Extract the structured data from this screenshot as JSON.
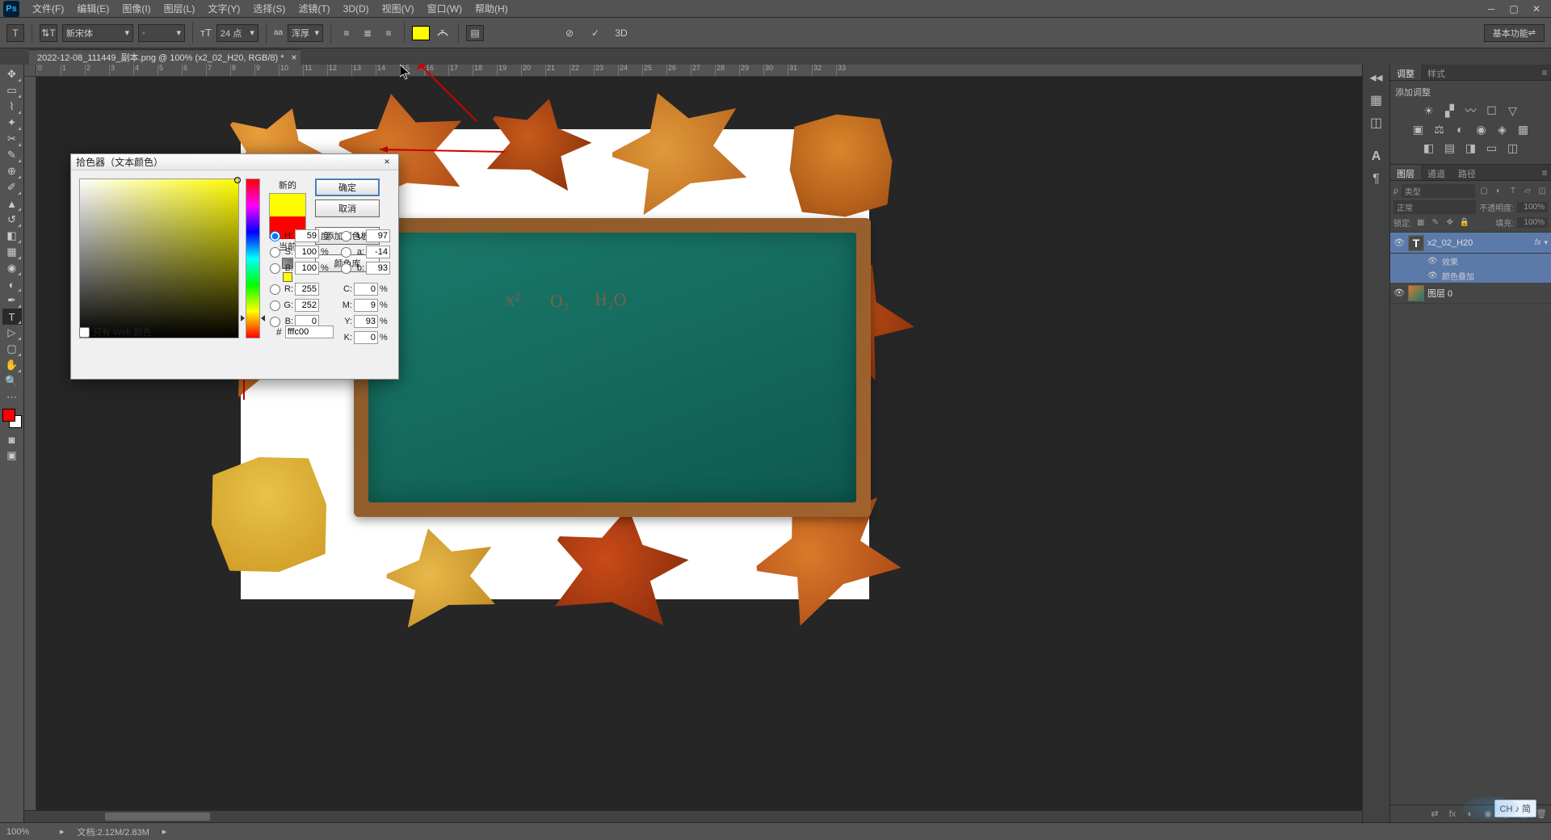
{
  "menu": {
    "file": "文件(F)",
    "edit": "编辑(E)",
    "image": "图像(I)",
    "layer": "图层(L)",
    "type": "文字(Y)",
    "select": "选择(S)",
    "filter": "滤镜(T)",
    "threed": "3D(D)",
    "view": "视图(V)",
    "window": "窗口(W)",
    "help": "帮助(H)"
  },
  "optbar": {
    "font": "新宋体",
    "style": "-",
    "sizeLabel": "T",
    "size": "24 点",
    "aa_label": "aa",
    "aa": "浑厚",
    "workspace": "基本功能",
    "threed": "3D"
  },
  "doc": {
    "tab": "2022-12-08_111449_副本.png @ 100% (x2_02_H20, RGB/8) *"
  },
  "dialog": {
    "title": "拾色器（文本颜色）",
    "newLabel": "新的",
    "curLabel": "当前",
    "ok": "确定",
    "cancel": "取消",
    "add": "添加到色板",
    "lib": "颜色库",
    "H": "59",
    "Hdeg": "度",
    "S": "100",
    "B": "100",
    "R": "255",
    "G": "252",
    "Bb": "0",
    "L": "97",
    "a": "-14",
    "b": "93",
    "C": "0",
    "M": "9",
    "Y": "93",
    "K": "0",
    "hex": "fffc00",
    "webonly": "只有 Web 颜色",
    "pct": "%"
  },
  "adjustments": {
    "tab1": "调整",
    "tab2": "样式",
    "title": "添加调整"
  },
  "layers": {
    "tab1": "图层",
    "tab2": "通道",
    "tab3": "路径",
    "kind": "类型",
    "normal": "正常",
    "opacityLabel": "不透明度:",
    "opacity": "100%",
    "lockLabel": "锁定:",
    "fillLabel": "填充:",
    "fill": "100%",
    "textLayer": "x2_02_H20",
    "fx": "fx",
    "effects": "效果",
    "colorOverlay": "颜色叠加",
    "bgLayer": "图层 0"
  },
  "status": {
    "zoom": "100%",
    "doc": "文档:2.12M/2.83M"
  },
  "formulas": {
    "f1": "x²",
    "f2": "O₂",
    "f3": "H₂O"
  },
  "ruler": [
    "0",
    "1",
    "2",
    "3",
    "4",
    "5",
    "6",
    "7",
    "8",
    "9",
    "10",
    "11",
    "12",
    "13",
    "14",
    "15",
    "16",
    "17",
    "18",
    "19",
    "20",
    "21",
    "22",
    "23",
    "24",
    "25",
    "26",
    "27",
    "28",
    "29",
    "30",
    "31",
    "32",
    "33"
  ],
  "ime": "CH ♪ 简"
}
